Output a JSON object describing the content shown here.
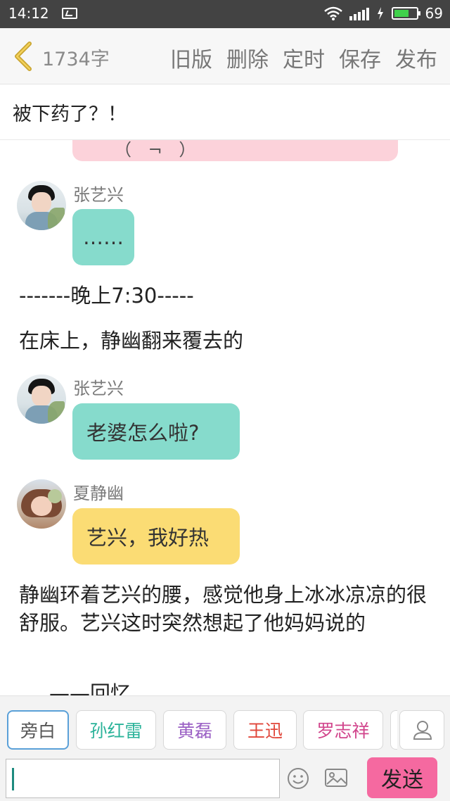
{
  "status_bar": {
    "time": "14:12",
    "battery_level": "69",
    "battery_fill_fraction": 0.69,
    "battery_color": "#3fd24b"
  },
  "toolbar": {
    "word_count": "1734字",
    "actions": [
      "旧版",
      "删除",
      "定时",
      "保存",
      "发布"
    ]
  },
  "chapter": {
    "title": "被下药了？！"
  },
  "story": {
    "previous_bubble_fragment": "（ ¬ ）",
    "items": [
      {
        "type": "chat",
        "speaker": "张艺兴",
        "text": "……",
        "bubble_color": "#86dbcc"
      },
      {
        "type": "narration",
        "text": "-------晚上7:30-----"
      },
      {
        "type": "narration",
        "text": "在床上，静幽翻来覆去的"
      },
      {
        "type": "chat",
        "speaker": "张艺兴",
        "text": "老婆怎么啦?",
        "bubble_color": "#86dbcc"
      },
      {
        "type": "chat",
        "speaker": "夏静幽",
        "text": "艺兴，我好热",
        "bubble_color": "#fbdc74"
      },
      {
        "type": "narration",
        "text": "静幽环着艺兴的腰，感觉他身上冰冰凉凉的很舒服。艺兴这时突然想起了他妈妈说的"
      },
      {
        "type": "narration",
        "text": "——回忆"
      }
    ]
  },
  "characters": [
    {
      "name": "旁白",
      "color": "#555555",
      "selected": true
    },
    {
      "name": "孙红雷",
      "color": "#2bb39a"
    },
    {
      "name": "黄磊",
      "color": "#9a5fc4"
    },
    {
      "name": "王迅",
      "color": "#e0463a"
    },
    {
      "name": "罗志祥",
      "color": "#d1458c"
    }
  ],
  "composer": {
    "input_value": "",
    "send_label": "发送",
    "send_color": "#f569a0",
    "icons": [
      "person-icon",
      "emoji-icon",
      "image-icon"
    ]
  }
}
